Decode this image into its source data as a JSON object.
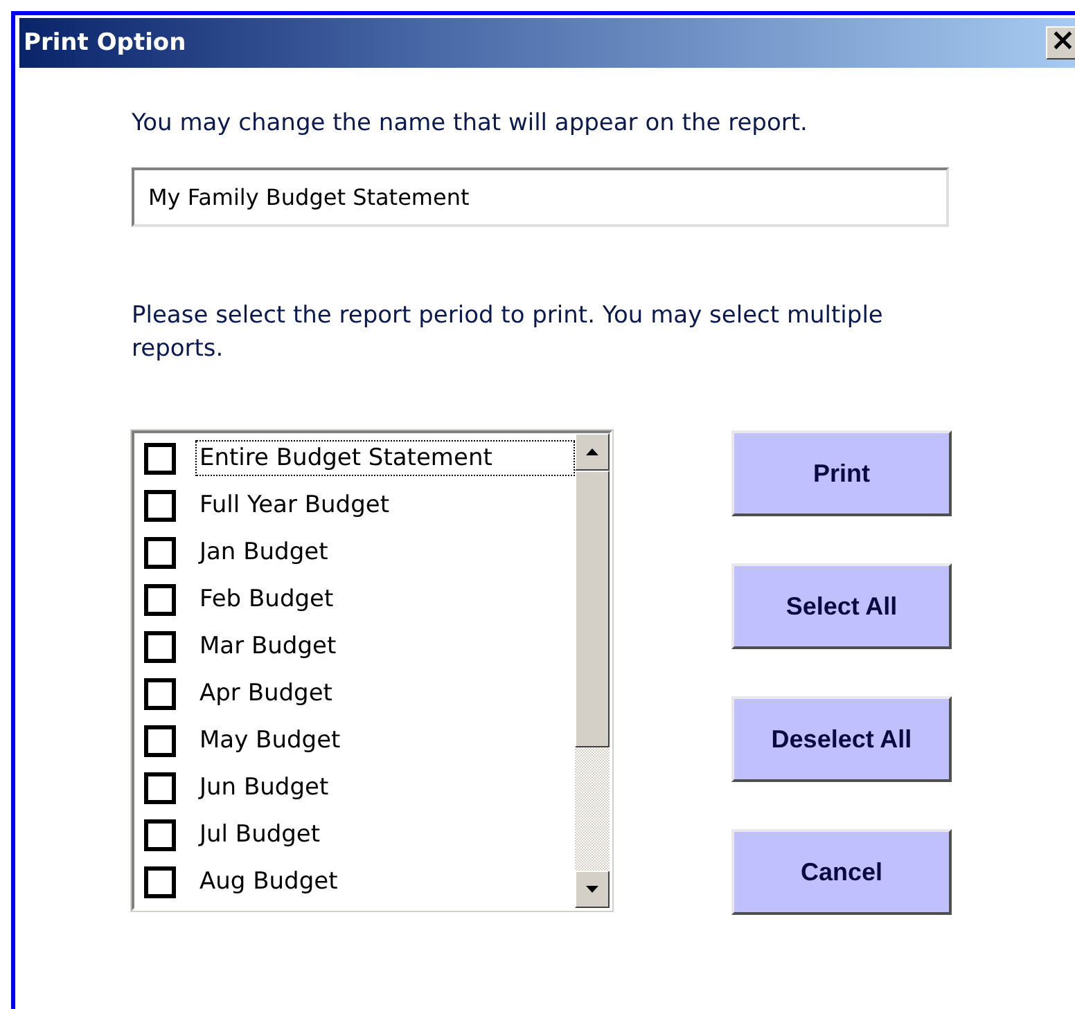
{
  "window": {
    "title": "Print Option",
    "close_label": "×"
  },
  "name_prompt": "You may change the name that will appear on the report.",
  "name_field": {
    "value": "My Family Budget Statement"
  },
  "period_prompt": "Please select the report period to print.  You may select multiple reports.",
  "reports": [
    {
      "label": "Entire Budget Statement",
      "checked": false,
      "focused": true
    },
    {
      "label": "Full Year Budget",
      "checked": false,
      "focused": false
    },
    {
      "label": "Jan Budget",
      "checked": false,
      "focused": false
    },
    {
      "label": "Feb Budget",
      "checked": false,
      "focused": false
    },
    {
      "label": "Mar Budget",
      "checked": false,
      "focused": false
    },
    {
      "label": "Apr Budget",
      "checked": false,
      "focused": false
    },
    {
      "label": "May Budget",
      "checked": false,
      "focused": false
    },
    {
      "label": "Jun Budget",
      "checked": false,
      "focused": false
    },
    {
      "label": "Jul Budget",
      "checked": false,
      "focused": false
    },
    {
      "label": "Aug Budget",
      "checked": false,
      "focused": false
    }
  ],
  "buttons": [
    "Print",
    "Select All",
    "Deselect All",
    "Cancel"
  ]
}
